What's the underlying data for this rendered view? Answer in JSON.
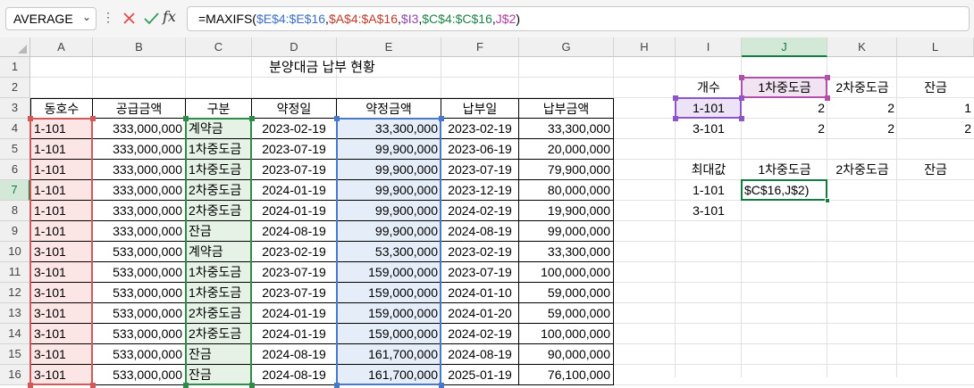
{
  "formula_bar": {
    "name_box": "AVERAGE",
    "dots": "⋮",
    "cancel_icon": "close-icon",
    "enter_icon": "check-icon",
    "fx_label": "fx",
    "formula_parts": [
      {
        "text": "=MAXIFS(",
        "color": "#000000"
      },
      {
        "text": "$E$4:$E$16",
        "color": "#3a6fc4"
      },
      {
        "text": ",",
        "color": "#000000"
      },
      {
        "text": "$A$4:$A$16",
        "color": "#c0392b"
      },
      {
        "text": ",",
        "color": "#000000"
      },
      {
        "text": "$I3",
        "color": "#8e44ad"
      },
      {
        "text": ",",
        "color": "#000000"
      },
      {
        "text": "$C$4:$C$16",
        "color": "#1e8449"
      },
      {
        "text": ",",
        "color": "#000000"
      },
      {
        "text": "J$2",
        "color": "#b03a9b"
      },
      {
        "text": ")",
        "color": "#000000"
      }
    ]
  },
  "columns": [
    "A",
    "B",
    "C",
    "D",
    "E",
    "F",
    "G",
    "H",
    "I",
    "J",
    "K",
    "L"
  ],
  "rows": [
    "1",
    "2",
    "3",
    "4",
    "5",
    "6",
    "7",
    "8",
    "9",
    "10",
    "11",
    "12",
    "13",
    "14",
    "15",
    "16"
  ],
  "sheet": {
    "title": "분양대금 납부 현황",
    "table_headers": [
      "동호수",
      "공급금액",
      "구분",
      "약정일",
      "약정금액",
      "납부일",
      "납부금액"
    ],
    "table_rows": [
      [
        "1-101",
        "333,000,000",
        "계약금",
        "2023-02-19",
        "33,300,000",
        "2023-02-19",
        "33,300,000"
      ],
      [
        "1-101",
        "333,000,000",
        "1차중도금",
        "2023-07-19",
        "99,900,000",
        "2023-06-19",
        "20,000,000"
      ],
      [
        "1-101",
        "333,000,000",
        "1차중도금",
        "2023-07-19",
        "99,900,000",
        "2023-07-19",
        "79,900,000"
      ],
      [
        "1-101",
        "333,000,000",
        "2차중도금",
        "2024-01-19",
        "99,900,000",
        "2023-12-19",
        "80,000,000"
      ],
      [
        "1-101",
        "333,000,000",
        "2차중도금",
        "2024-01-19",
        "99,900,000",
        "2024-02-19",
        "19,900,000"
      ],
      [
        "1-101",
        "333,000,000",
        "잔금",
        "2024-08-19",
        "99,900,000",
        "2024-08-19",
        "99,000,000"
      ],
      [
        "3-101",
        "533,000,000",
        "계약금",
        "2023-02-19",
        "53,300,000",
        "2023-02-19",
        "33,300,000"
      ],
      [
        "3-101",
        "533,000,000",
        "1차중도금",
        "2023-07-19",
        "159,000,000",
        "2023-07-19",
        "100,000,000"
      ],
      [
        "3-101",
        "533,000,000",
        "1차중도금",
        "2023-07-19",
        "159,000,000",
        "2024-01-10",
        "59,000,000"
      ],
      [
        "3-101",
        "533,000,000",
        "2차중도금",
        "2024-01-19",
        "159,000,000",
        "2024-01-20",
        "59,000,000"
      ],
      [
        "3-101",
        "533,000,000",
        "2차중도금",
        "2024-01-19",
        "159,000,000",
        "2024-02-19",
        "100,000,000"
      ],
      [
        "3-101",
        "533,000,000",
        "잔금",
        "2024-08-19",
        "161,700,000",
        "2024-08-19",
        "90,000,000"
      ],
      [
        "3-101",
        "533,000,000",
        "잔금",
        "2024-08-19",
        "161,700,000",
        "2025-01-19",
        "76,100,000"
      ]
    ],
    "count_table": {
      "headers": [
        "개수",
        "1차중도금",
        "2차중도금",
        "잔금"
      ],
      "rows": [
        [
          "1-101",
          "2",
          "2",
          "1"
        ],
        [
          "3-101",
          "2",
          "2",
          "2"
        ]
      ]
    },
    "max_table": {
      "headers": [
        "최대값",
        "1차중도금",
        "2차중도금",
        "잔금"
      ],
      "rows": [
        [
          "1-101",
          "$C$16,J$2)",
          "",
          ""
        ],
        [
          "3-101",
          "",
          "",
          ""
        ]
      ]
    }
  }
}
